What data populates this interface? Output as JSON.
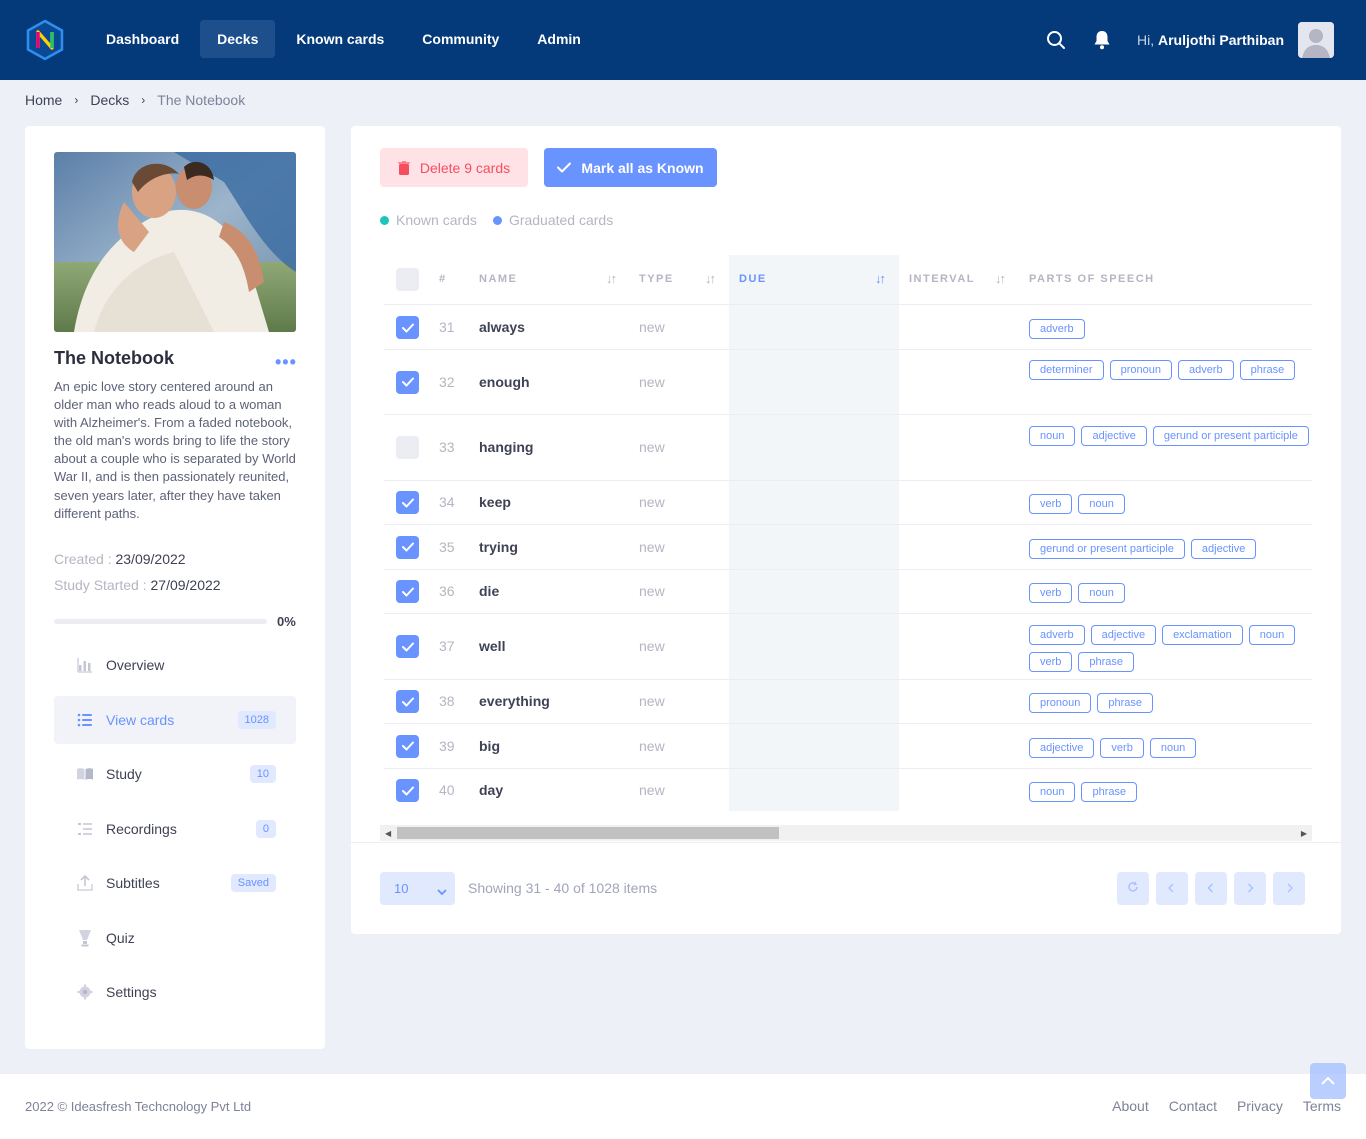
{
  "header": {
    "nav": [
      "Dashboard",
      "Decks",
      "Known cards",
      "Community",
      "Admin"
    ],
    "active_nav": "Decks",
    "greeting": "Hi,",
    "user_name": "Aruljothi Parthiban"
  },
  "breadcrumb": [
    "Home",
    "Decks",
    "The Notebook"
  ],
  "deck": {
    "title": "The Notebook",
    "description": "An epic love story centered around an older man who reads aloud to a woman with Alzheimer's. From a faded notebook, the old man's words bring to life the story about a couple who is separated by World War II, and is then passionately reunited, seven years later, after they have taken different paths.",
    "created_label": "Created :",
    "created": "23/09/2022",
    "study_started_label": "Study Started :",
    "study_started": "27/09/2022",
    "progress": "0%"
  },
  "menu": [
    {
      "label": "Overview",
      "badge": ""
    },
    {
      "label": "View cards",
      "badge": "1028"
    },
    {
      "label": "Study",
      "badge": "10"
    },
    {
      "label": "Recordings",
      "badge": "0"
    },
    {
      "label": "Subtitles",
      "badge": "Saved"
    },
    {
      "label": "Quiz",
      "badge": ""
    },
    {
      "label": "Settings",
      "badge": ""
    }
  ],
  "actions": {
    "delete_label": "Delete 9 cards",
    "known_label": "Mark all as Known"
  },
  "legend": [
    {
      "label": "Known cards",
      "color": "#1bc5bd"
    },
    {
      "label": "Graduated cards",
      "color": "#6993ff"
    }
  ],
  "table": {
    "columns": [
      "#",
      "NAME",
      "TYPE",
      "DUE",
      "INTERVAL",
      "PARTS OF SPEECH"
    ],
    "rows": [
      {
        "checked": true,
        "num": "31",
        "name": "always",
        "type": "new",
        "tags": [
          "adverb"
        ]
      },
      {
        "checked": true,
        "num": "32",
        "name": "enough",
        "type": "new",
        "tags": [
          "determiner",
          "pronoun",
          "adverb",
          "phrase"
        ]
      },
      {
        "checked": false,
        "num": "33",
        "name": "hanging",
        "type": "new",
        "tags": [
          "noun",
          "adjective",
          "gerund or present participle"
        ]
      },
      {
        "checked": true,
        "num": "34",
        "name": "keep",
        "type": "new",
        "tags": [
          "verb",
          "noun"
        ]
      },
      {
        "checked": true,
        "num": "35",
        "name": "trying",
        "type": "new",
        "tags": [
          "gerund or present participle",
          "adjective"
        ]
      },
      {
        "checked": true,
        "num": "36",
        "name": "die",
        "type": "new",
        "tags": [
          "verb",
          "noun"
        ]
      },
      {
        "checked": true,
        "num": "37",
        "name": "well",
        "type": "new",
        "tags": [
          "adverb",
          "adjective",
          "exclamation",
          "noun",
          "verb",
          "phrase"
        ]
      },
      {
        "checked": true,
        "num": "38",
        "name": "everything",
        "type": "new",
        "tags": [
          "pronoun",
          "phrase"
        ]
      },
      {
        "checked": true,
        "num": "39",
        "name": "big",
        "type": "new",
        "tags": [
          "adjective",
          "verb",
          "noun"
        ]
      },
      {
        "checked": true,
        "num": "40",
        "name": "day",
        "type": "new",
        "tags": [
          "noun",
          "phrase"
        ]
      }
    ]
  },
  "pager": {
    "page_size": "10",
    "showing": "Showing 31 - 40 of 1028 items"
  },
  "footer": {
    "copyright": "2022 © Ideasfresh Techcnology Pvt Ltd",
    "links": [
      "About",
      "Contact",
      "Privacy",
      "Terms"
    ]
  }
}
